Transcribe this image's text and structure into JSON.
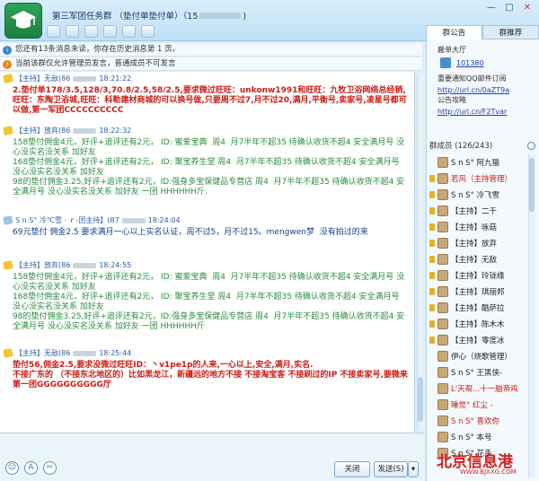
{
  "window": {
    "title": "第三军团任务群 （垫付单垫付单）（15",
    "title_masked_suffix": ")",
    "minimize": "—",
    "maximize": "□",
    "close": "✕"
  },
  "notices": {
    "unread": "您还有13条消息未读，你存在历史消息第 1 页。",
    "admin_only": "当前该群仅允许管理员发言，普通成员不可发言"
  },
  "messages": [
    {
      "sender": "【主持】无敌(86",
      "time": "18:21:22",
      "style": "red",
      "text": "2.垫付单178/3.5,128/3,70.8/2.5,58/2.5,要求微过旺旺：unkonw1991和旺旺：九牧卫浴网络总经销,旺旺：东陶卫浴城,旺旺：科勒建材商城的可以换号做,只要周不过7,月不过20,满月,平衡号,卖家号,凌星号都可以做,第一军团CCCCCCCCCC"
    },
    {
      "sender": "【主持】放弃(86",
      "time": "18:22:32",
      "style": "green",
      "text": "158垫付佣金4元，好评+追评还有2元， ID: 蜜爱宝典  周4  月7半年不超35 待确认收货不超4 安全满月号 没心没实名没关系 加好友\n168垫付佣金4元，好评+追评还有2元， ID: 聚宝养生堂 周4  月7半年不超35 待确认收货不超4 安全满月号 没心没实名没关系 加好友\n98的垫付佣金3.25,好评+追评还有2元，ID:强身多宝保健品专营店 周4  月7半年不超35 待确认收货不超4 安全满月号 没心没实名没关系 加好友 一团 HHHHHH斤."
    },
    {
      "sender": "S n S° 冷℃雪 ·  ｒ-团主持】(87",
      "time": "18:24:04",
      "style": "blue",
      "text": "69元垫付 佣金2.5 要求满月一心以上实名认证，周不过5，月不过15。mengwen梦  没有拍过的来"
    },
    {
      "sender": "【主持】放弃(86",
      "time": "18:24:55",
      "style": "green",
      "text": "158垫付佣金4元，好评+追评还有2元， ID: 蜜爱宝典  周4  月7半年不超35 待确认收货不超4 安全满月号 没心没实名没关系 加好友\n168垫付佣金4元，好评+追评还有2元， ID: 聚宝养生堂 周4  月7半年不超35 待确认收货不超4 安全满月号 没心没实名没关系 加好友\n98的垫付佣金3.25,好评+追评还有2元，ID:强身多宝保健品专营店 周4  月7半年不超35 待确认收货不超4 安全满月号 没心没实名没关系 加好友 一团 HHHHHH斤"
    },
    {
      "sender": "【主持】无敌(86",
      "time": "18:25:44",
      "style": "red",
      "text": "垫付56,佣金2.5,要求没微过旺旺ID：丶v1pe1p的人来,一心以上,安全,满月,实名.\n不接广东的 （不接东北地区的）比如黑龙江，新疆远的地方不接 不接淘宝客 不接刷过的IP 不接卖家号,要微来第一团GGGGGGGGGG厅"
    }
  ],
  "buttons": {
    "close": "关闭",
    "send": "发送(S)",
    "send_arrow": "▾"
  },
  "tabs": {
    "announcement": "群公告",
    "recommend": "群推荐"
  },
  "right_panel": {
    "hall_label": "搬单大厅",
    "hall_number": "101380",
    "important_label": "重要通知QQ邮件订阅",
    "link1": "http://url.cn/0aZT9a",
    "strategy_label": "公告攻略",
    "link2": "http://url.cn/F2Tvar"
  },
  "members": {
    "header": "群成员 (126/243)",
    "list": [
      {
        "name": "S n S°  阿九猫",
        "crown": false
      },
      {
        "name": "若风（主持管理）",
        "crown": true,
        "color": "#cc1b14"
      },
      {
        "name": "S n S°   冷飞雪",
        "crown": true
      },
      {
        "name": "【主持】二千",
        "crown": true
      },
      {
        "name": "【主持】咏菇",
        "crown": true
      },
      {
        "name": "【主持】放弃",
        "crown": true
      },
      {
        "name": "【主持】无敌",
        "crown": true
      },
      {
        "name": "【主持】玲珑缘",
        "crown": true
      },
      {
        "name": "【主持】琪丽邦",
        "crown": true
      },
      {
        "name": "【主持】酷萨拉",
        "crown": true
      },
      {
        "name": "【主持】陈木木",
        "crown": true
      },
      {
        "name": "【主持】零度冰",
        "crown": true
      },
      {
        "name": "伊心（烧歌管理）",
        "crown": false
      },
      {
        "name": "S n S°  王黑侠-",
        "crown": false
      },
      {
        "name": "L'天帮...十一脑帝鸡",
        "crown": false,
        "color": "#cc1b14"
      },
      {
        "name": "睡觉°  红尘 -  ",
        "crown": false,
        "color": "#cc1b14"
      },
      {
        "name": "S n S°  喜欢你",
        "crown": false,
        "color": "#cc1b14"
      },
      {
        "name": "S n S°  本号",
        "crown": false
      },
      {
        "name": "S n S°  花手",
        "crown": false
      }
    ]
  },
  "watermark": {
    "text": "北京信息港",
    "url": "WWW.BJXXG.COM"
  }
}
